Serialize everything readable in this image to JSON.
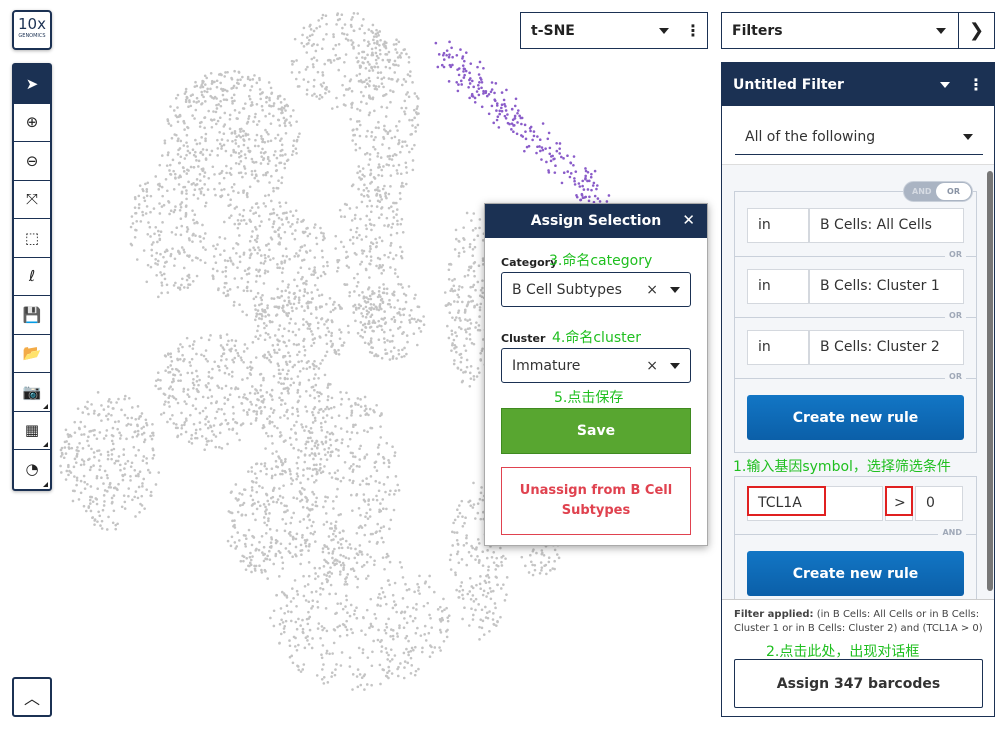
{
  "logo": {
    "text": "10x",
    "sub": "GENOMICS"
  },
  "toolbar": {
    "tools": [
      {
        "name": "select",
        "icon": "cursor-icon",
        "glyph": "➤"
      },
      {
        "name": "zoom-in",
        "icon": "zoom-in-icon",
        "glyph": "⊕"
      },
      {
        "name": "zoom-out",
        "icon": "zoom-out-icon",
        "glyph": "⊖"
      },
      {
        "name": "fit",
        "icon": "expand-icon",
        "glyph": "⤧"
      },
      {
        "name": "rect-select",
        "icon": "rectangle-select-icon",
        "glyph": "⬚"
      },
      {
        "name": "lasso",
        "icon": "lasso-icon",
        "glyph": "ℓ"
      },
      {
        "name": "save",
        "icon": "save-icon",
        "glyph": "💾"
      },
      {
        "name": "open",
        "icon": "folder-open-icon",
        "glyph": "📂"
      },
      {
        "name": "screenshot",
        "icon": "camera-icon",
        "glyph": "📷"
      },
      {
        "name": "layout",
        "icon": "grid-icon",
        "glyph": "▦"
      },
      {
        "name": "settings",
        "icon": "gauge-icon",
        "glyph": "◔"
      }
    ],
    "up_glyph": "︿"
  },
  "projection": {
    "selected": "t-SNE"
  },
  "filters_dropdown": {
    "selected": "Filters"
  },
  "filter": {
    "title": "Untitled Filter",
    "mode": "All of the following",
    "toggle": {
      "and": "AND",
      "or": "OR",
      "active": "OR"
    },
    "group1": [
      {
        "op": "in",
        "value": "B Cells: All Cells"
      },
      {
        "op": "in",
        "value": "B Cells: Cluster 1"
      },
      {
        "op": "in",
        "value": "B Cells: Cluster 2"
      }
    ],
    "or_label": "OR",
    "and_label": "AND",
    "create_rule": "Create new rule",
    "gene_rule": {
      "gene": "TCL1A",
      "op": ">",
      "value": "0"
    },
    "applied_label": "Filter applied:",
    "applied_text": " (in B Cells: All Cells or in B Cells: Cluster 1 or in B Cells: Cluster 2) and (TCL1A > 0)",
    "assign_button": "Assign 347 barcodes"
  },
  "dialog": {
    "title": "Assign Selection",
    "close": "✕",
    "category_label": "Category",
    "category_value": "B Cell Subtypes",
    "cluster_label": "Cluster",
    "cluster_value": "Immature",
    "clear": "×",
    "save": "Save",
    "unassign": "Unassign from B Cell Subtypes"
  },
  "annotations": {
    "step1": "1.输入基因symbol，选择筛选条件",
    "step2": "2.点击此处，出现对话框",
    "step3": "3.命名category",
    "step4": "4.命名cluster",
    "step5": "5.点击保存"
  },
  "colors": {
    "navy": "#1b3153",
    "dots": "#c4c4c4",
    "selected_dots": "#8a5cc9",
    "save": "#58a630",
    "unassign": "#e0424f",
    "annotation": "#1fbf1f"
  }
}
